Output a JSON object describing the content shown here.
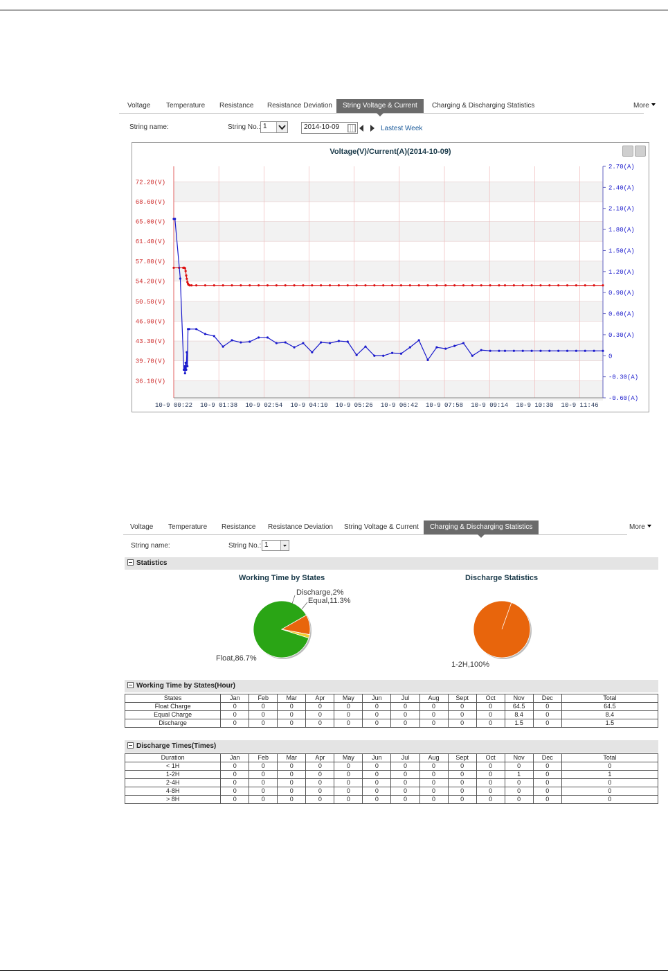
{
  "tabs_top": {
    "items": [
      "Voltage",
      "Temperature",
      "Resistance",
      "Resistance Deviation",
      "String Voltage & Current",
      "Charging & Discharging Statistics"
    ],
    "active": "String Voltage & Current",
    "more": "More"
  },
  "filter_top": {
    "string_name_label": "String name:",
    "string_no_label": "String No.:",
    "string_no_value": "1",
    "date_value": "2014-10-09",
    "latest_week_link": "Lastest Week"
  },
  "chart_data": {
    "type": "line",
    "title": "Voltage(V)/Current(A)(2014-10-09)",
    "x_ticks": [
      "10-9 00:22",
      "10-9 01:38",
      "10-9 02:54",
      "10-9 04:10",
      "10-9 05:26",
      "10-9 06:42",
      "10-9 07:58",
      "10-9 09:14",
      "10-9 10:30",
      "10-9 11:46"
    ],
    "x_range": [
      "00:22",
      "12:25"
    ],
    "y_left": {
      "ticks": [
        "72.20(V)",
        "68.60(V)",
        "65.00(V)",
        "61.40(V)",
        "57.80(V)",
        "54.20(V)",
        "50.50(V)",
        "46.90(V)",
        "43.30(V)",
        "39.70(V)",
        "36.10(V)"
      ],
      "range": [
        33.0,
        75.0
      ]
    },
    "y_right": {
      "ticks": [
        "2.70(A)",
        "2.40(A)",
        "2.10(A)",
        "1.80(A)",
        "1.50(A)",
        "1.20(A)",
        "0.90(A)",
        "0.60(A)",
        "0.30(A)",
        "0",
        "-0.30(A)",
        "-0.60(A)"
      ],
      "range": [
        -0.6,
        2.7
      ]
    },
    "series": [
      {
        "color": "#dd1111",
        "axis": "left",
        "x_minutes": [
          22,
          31,
          38,
          39,
          40,
          41,
          42,
          43,
          44,
          45,
          46,
          47,
          49,
          52,
          60,
          75,
          90,
          105,
          120,
          135,
          150,
          165,
          180,
          195,
          210,
          225,
          240,
          255,
          270,
          285,
          300,
          315,
          330,
          345,
          360,
          375,
          390,
          405,
          420,
          435,
          450,
          465,
          480,
          495,
          510,
          525,
          540,
          555,
          570,
          580,
          595,
          610,
          625,
          640,
          655,
          670,
          685,
          700,
          715,
          730,
          745
        ],
        "values": [
          56.6,
          56.6,
          56.6,
          56.6,
          56.6,
          56.5,
          56.0,
          55.2,
          54.6,
          54.0,
          53.7,
          53.5,
          53.4,
          53.4,
          53.4,
          53.4,
          53.4,
          53.4,
          53.4,
          53.4,
          53.4,
          53.4,
          53.4,
          53.4,
          53.4,
          53.4,
          53.4,
          53.4,
          53.4,
          53.4,
          53.4,
          53.4,
          53.4,
          53.4,
          53.4,
          53.4,
          53.4,
          53.4,
          53.4,
          53.4,
          53.4,
          53.4,
          53.4,
          53.4,
          53.4,
          53.4,
          53.4,
          53.4,
          53.4,
          53.4,
          53.4,
          53.4,
          53.4,
          53.4,
          53.4,
          53.4,
          53.4,
          53.4,
          53.4,
          53.4,
          53.4
        ]
      },
      {
        "color": "#1a1acc",
        "axis": "right",
        "x_minutes": [
          22,
          24,
          33,
          39,
          40,
          41,
          42,
          43,
          44,
          45,
          46,
          48,
          60,
          75,
          90,
          105,
          120,
          135,
          150,
          165,
          180,
          195,
          210,
          225,
          240,
          255,
          270,
          285,
          300,
          315,
          330,
          345,
          360,
          375,
          390,
          405,
          420,
          435,
          450,
          465,
          480,
          495,
          510,
          525,
          540,
          555,
          570,
          580,
          595,
          610,
          625,
          640,
          655,
          670,
          685,
          700,
          715,
          730,
          745
        ],
        "values": [
          1.95,
          1.95,
          1.1,
          -0.2,
          -0.15,
          -0.25,
          -0.1,
          -0.2,
          0.05,
          -0.15,
          0.38,
          0.38,
          0.38,
          0.31,
          0.28,
          0.13,
          0.22,
          0.19,
          0.2,
          0.26,
          0.26,
          0.18,
          0.19,
          0.12,
          0.18,
          0.05,
          0.19,
          0.18,
          0.21,
          0.2,
          0.01,
          0.13,
          0.0,
          0.0,
          0.04,
          0.03,
          0.12,
          0.22,
          -0.06,
          0.12,
          0.1,
          0.14,
          0.18,
          0.0,
          0.08,
          0.07,
          0.07,
          0.07,
          0.07,
          0.07,
          0.07,
          0.07,
          0.07,
          0.07,
          0.07,
          0.07,
          0.07,
          0.07,
          0.07
        ]
      }
    ],
    "grid": true
  },
  "tabs_bottom": {
    "items": [
      "Voltage",
      "Temperature",
      "Resistance",
      "Resistance Deviation",
      "String Voltage & Current",
      "Charging & Discharging Statistics"
    ],
    "active": "Charging & Discharging Statistics",
    "more": "More"
  },
  "filter_bottom": {
    "string_name_label": "String name:",
    "string_no_label": "String No.:",
    "string_no_value": "1"
  },
  "statistics": {
    "section_title": "Statistics",
    "pie1": {
      "title": "Working Time by States",
      "slices": [
        {
          "label": "Float,86.7%",
          "value": 86.7,
          "color": "#2aa515"
        },
        {
          "label": "Equal,11.3%",
          "value": 11.3,
          "color": "#e8650c"
        },
        {
          "label": "Discharge,2%",
          "value": 2.0,
          "color": "#f0d030"
        }
      ]
    },
    "pie2": {
      "title": "Discharge Statistics",
      "slices": [
        {
          "label": "1-2H,100%",
          "value": 100,
          "color": "#e8650c"
        }
      ]
    }
  },
  "working_time_table": {
    "section_title": "Working Time by States(Hour)",
    "headers": [
      "States",
      "Jan",
      "Feb",
      "Mar",
      "Apr",
      "May",
      "Jun",
      "Jul",
      "Aug",
      "Sept",
      "Oct",
      "Nov",
      "Dec",
      "Total"
    ],
    "rows": [
      [
        "Float Charge",
        "0",
        "0",
        "0",
        "0",
        "0",
        "0",
        "0",
        "0",
        "0",
        "0",
        "64.5",
        "0",
        "64.5"
      ],
      [
        "Equal Charge",
        "0",
        "0",
        "0",
        "0",
        "0",
        "0",
        "0",
        "0",
        "0",
        "0",
        "8.4",
        "0",
        "8.4"
      ],
      [
        "Discharge",
        "0",
        "0",
        "0",
        "0",
        "0",
        "0",
        "0",
        "0",
        "0",
        "0",
        "1.5",
        "0",
        "1.5"
      ]
    ]
  },
  "discharge_table": {
    "section_title": "Discharge Times(Times)",
    "headers": [
      "Duration",
      "Jan",
      "Feb",
      "Mar",
      "Apr",
      "May",
      "Jun",
      "Jul",
      "Aug",
      "Sept",
      "Oct",
      "Nov",
      "Dec",
      "Total"
    ],
    "rows": [
      [
        "< 1H",
        "0",
        "0",
        "0",
        "0",
        "0",
        "0",
        "0",
        "0",
        "0",
        "0",
        "0",
        "0",
        "0"
      ],
      [
        "1-2H",
        "0",
        "0",
        "0",
        "0",
        "0",
        "0",
        "0",
        "0",
        "0",
        "0",
        "1",
        "0",
        "1"
      ],
      [
        "2-4H",
        "0",
        "0",
        "0",
        "0",
        "0",
        "0",
        "0",
        "0",
        "0",
        "0",
        "0",
        "0",
        "0"
      ],
      [
        "4-8H",
        "0",
        "0",
        "0",
        "0",
        "0",
        "0",
        "0",
        "0",
        "0",
        "0",
        "0",
        "0",
        "0"
      ],
      [
        "> 8H",
        "0",
        "0",
        "0",
        "0",
        "0",
        "0",
        "0",
        "0",
        "0",
        "0",
        "0",
        "0",
        "0"
      ]
    ]
  }
}
